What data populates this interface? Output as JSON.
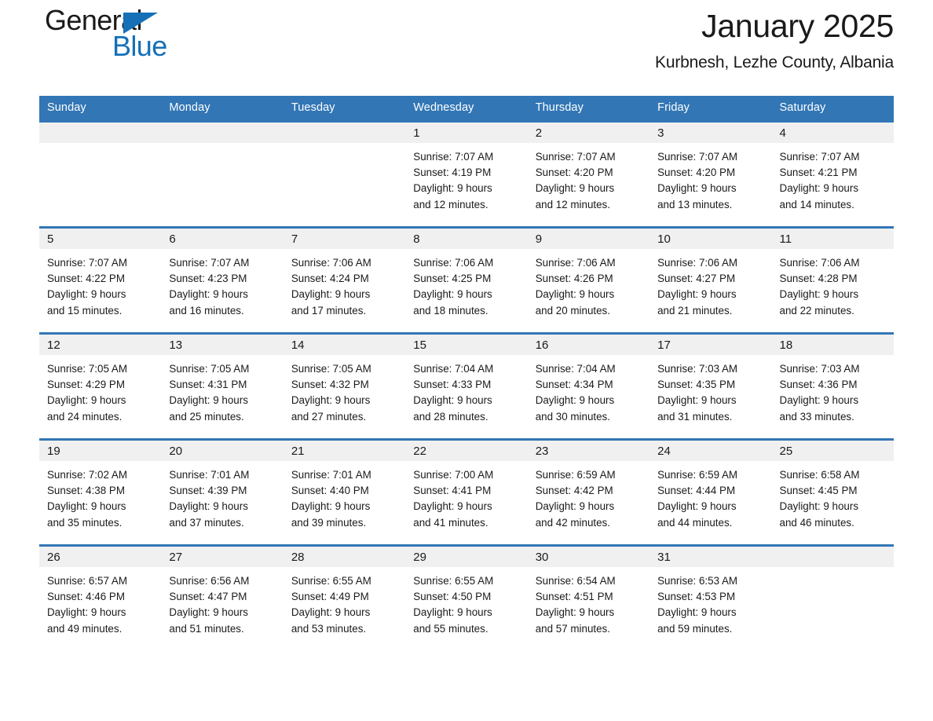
{
  "brand": {
    "line1": "General",
    "line2": "Blue",
    "triangle_color": "#1570b8",
    "icon": "triangle-icon"
  },
  "header": {
    "title": "January 2025",
    "subtitle": "Kurbnesh, Lezhe County, Albania"
  },
  "colors": {
    "accent": "#3276b5",
    "brand_blue": "#1570b8",
    "daynum_band": "#f0f0f0",
    "text": "#1a1a1a"
  },
  "calendar": {
    "weekday_headers": [
      "Sunday",
      "Monday",
      "Tuesday",
      "Wednesday",
      "Thursday",
      "Friday",
      "Saturday"
    ],
    "weeks": [
      [
        {
          "blank": true
        },
        {
          "blank": true
        },
        {
          "blank": true
        },
        {
          "day": "1",
          "sunrise": "Sunrise: 7:07 AM",
          "sunset": "Sunset: 4:19 PM",
          "daylight1": "Daylight: 9 hours",
          "daylight2": "and 12 minutes."
        },
        {
          "day": "2",
          "sunrise": "Sunrise: 7:07 AM",
          "sunset": "Sunset: 4:20 PM",
          "daylight1": "Daylight: 9 hours",
          "daylight2": "and 12 minutes."
        },
        {
          "day": "3",
          "sunrise": "Sunrise: 7:07 AM",
          "sunset": "Sunset: 4:20 PM",
          "daylight1": "Daylight: 9 hours",
          "daylight2": "and 13 minutes."
        },
        {
          "day": "4",
          "sunrise": "Sunrise: 7:07 AM",
          "sunset": "Sunset: 4:21 PM",
          "daylight1": "Daylight: 9 hours",
          "daylight2": "and 14 minutes."
        }
      ],
      [
        {
          "day": "5",
          "sunrise": "Sunrise: 7:07 AM",
          "sunset": "Sunset: 4:22 PM",
          "daylight1": "Daylight: 9 hours",
          "daylight2": "and 15 minutes."
        },
        {
          "day": "6",
          "sunrise": "Sunrise: 7:07 AM",
          "sunset": "Sunset: 4:23 PM",
          "daylight1": "Daylight: 9 hours",
          "daylight2": "and 16 minutes."
        },
        {
          "day": "7",
          "sunrise": "Sunrise: 7:06 AM",
          "sunset": "Sunset: 4:24 PM",
          "daylight1": "Daylight: 9 hours",
          "daylight2": "and 17 minutes."
        },
        {
          "day": "8",
          "sunrise": "Sunrise: 7:06 AM",
          "sunset": "Sunset: 4:25 PM",
          "daylight1": "Daylight: 9 hours",
          "daylight2": "and 18 minutes."
        },
        {
          "day": "9",
          "sunrise": "Sunrise: 7:06 AM",
          "sunset": "Sunset: 4:26 PM",
          "daylight1": "Daylight: 9 hours",
          "daylight2": "and 20 minutes."
        },
        {
          "day": "10",
          "sunrise": "Sunrise: 7:06 AM",
          "sunset": "Sunset: 4:27 PM",
          "daylight1": "Daylight: 9 hours",
          "daylight2": "and 21 minutes."
        },
        {
          "day": "11",
          "sunrise": "Sunrise: 7:06 AM",
          "sunset": "Sunset: 4:28 PM",
          "daylight1": "Daylight: 9 hours",
          "daylight2": "and 22 minutes."
        }
      ],
      [
        {
          "day": "12",
          "sunrise": "Sunrise: 7:05 AM",
          "sunset": "Sunset: 4:29 PM",
          "daylight1": "Daylight: 9 hours",
          "daylight2": "and 24 minutes."
        },
        {
          "day": "13",
          "sunrise": "Sunrise: 7:05 AM",
          "sunset": "Sunset: 4:31 PM",
          "daylight1": "Daylight: 9 hours",
          "daylight2": "and 25 minutes."
        },
        {
          "day": "14",
          "sunrise": "Sunrise: 7:05 AM",
          "sunset": "Sunset: 4:32 PM",
          "daylight1": "Daylight: 9 hours",
          "daylight2": "and 27 minutes."
        },
        {
          "day": "15",
          "sunrise": "Sunrise: 7:04 AM",
          "sunset": "Sunset: 4:33 PM",
          "daylight1": "Daylight: 9 hours",
          "daylight2": "and 28 minutes."
        },
        {
          "day": "16",
          "sunrise": "Sunrise: 7:04 AM",
          "sunset": "Sunset: 4:34 PM",
          "daylight1": "Daylight: 9 hours",
          "daylight2": "and 30 minutes."
        },
        {
          "day": "17",
          "sunrise": "Sunrise: 7:03 AM",
          "sunset": "Sunset: 4:35 PM",
          "daylight1": "Daylight: 9 hours",
          "daylight2": "and 31 minutes."
        },
        {
          "day": "18",
          "sunrise": "Sunrise: 7:03 AM",
          "sunset": "Sunset: 4:36 PM",
          "daylight1": "Daylight: 9 hours",
          "daylight2": "and 33 minutes."
        }
      ],
      [
        {
          "day": "19",
          "sunrise": "Sunrise: 7:02 AM",
          "sunset": "Sunset: 4:38 PM",
          "daylight1": "Daylight: 9 hours",
          "daylight2": "and 35 minutes."
        },
        {
          "day": "20",
          "sunrise": "Sunrise: 7:01 AM",
          "sunset": "Sunset: 4:39 PM",
          "daylight1": "Daylight: 9 hours",
          "daylight2": "and 37 minutes."
        },
        {
          "day": "21",
          "sunrise": "Sunrise: 7:01 AM",
          "sunset": "Sunset: 4:40 PM",
          "daylight1": "Daylight: 9 hours",
          "daylight2": "and 39 minutes."
        },
        {
          "day": "22",
          "sunrise": "Sunrise: 7:00 AM",
          "sunset": "Sunset: 4:41 PM",
          "daylight1": "Daylight: 9 hours",
          "daylight2": "and 41 minutes."
        },
        {
          "day": "23",
          "sunrise": "Sunrise: 6:59 AM",
          "sunset": "Sunset: 4:42 PM",
          "daylight1": "Daylight: 9 hours",
          "daylight2": "and 42 minutes."
        },
        {
          "day": "24",
          "sunrise": "Sunrise: 6:59 AM",
          "sunset": "Sunset: 4:44 PM",
          "daylight1": "Daylight: 9 hours",
          "daylight2": "and 44 minutes."
        },
        {
          "day": "25",
          "sunrise": "Sunrise: 6:58 AM",
          "sunset": "Sunset: 4:45 PM",
          "daylight1": "Daylight: 9 hours",
          "daylight2": "and 46 minutes."
        }
      ],
      [
        {
          "day": "26",
          "sunrise": "Sunrise: 6:57 AM",
          "sunset": "Sunset: 4:46 PM",
          "daylight1": "Daylight: 9 hours",
          "daylight2": "and 49 minutes."
        },
        {
          "day": "27",
          "sunrise": "Sunrise: 6:56 AM",
          "sunset": "Sunset: 4:47 PM",
          "daylight1": "Daylight: 9 hours",
          "daylight2": "and 51 minutes."
        },
        {
          "day": "28",
          "sunrise": "Sunrise: 6:55 AM",
          "sunset": "Sunset: 4:49 PM",
          "daylight1": "Daylight: 9 hours",
          "daylight2": "and 53 minutes."
        },
        {
          "day": "29",
          "sunrise": "Sunrise: 6:55 AM",
          "sunset": "Sunset: 4:50 PM",
          "daylight1": "Daylight: 9 hours",
          "daylight2": "and 55 minutes."
        },
        {
          "day": "30",
          "sunrise": "Sunrise: 6:54 AM",
          "sunset": "Sunset: 4:51 PM",
          "daylight1": "Daylight: 9 hours",
          "daylight2": "and 57 minutes."
        },
        {
          "day": "31",
          "sunrise": "Sunrise: 6:53 AM",
          "sunset": "Sunset: 4:53 PM",
          "daylight1": "Daylight: 9 hours",
          "daylight2": "and 59 minutes."
        },
        {
          "blank": true
        }
      ]
    ]
  }
}
